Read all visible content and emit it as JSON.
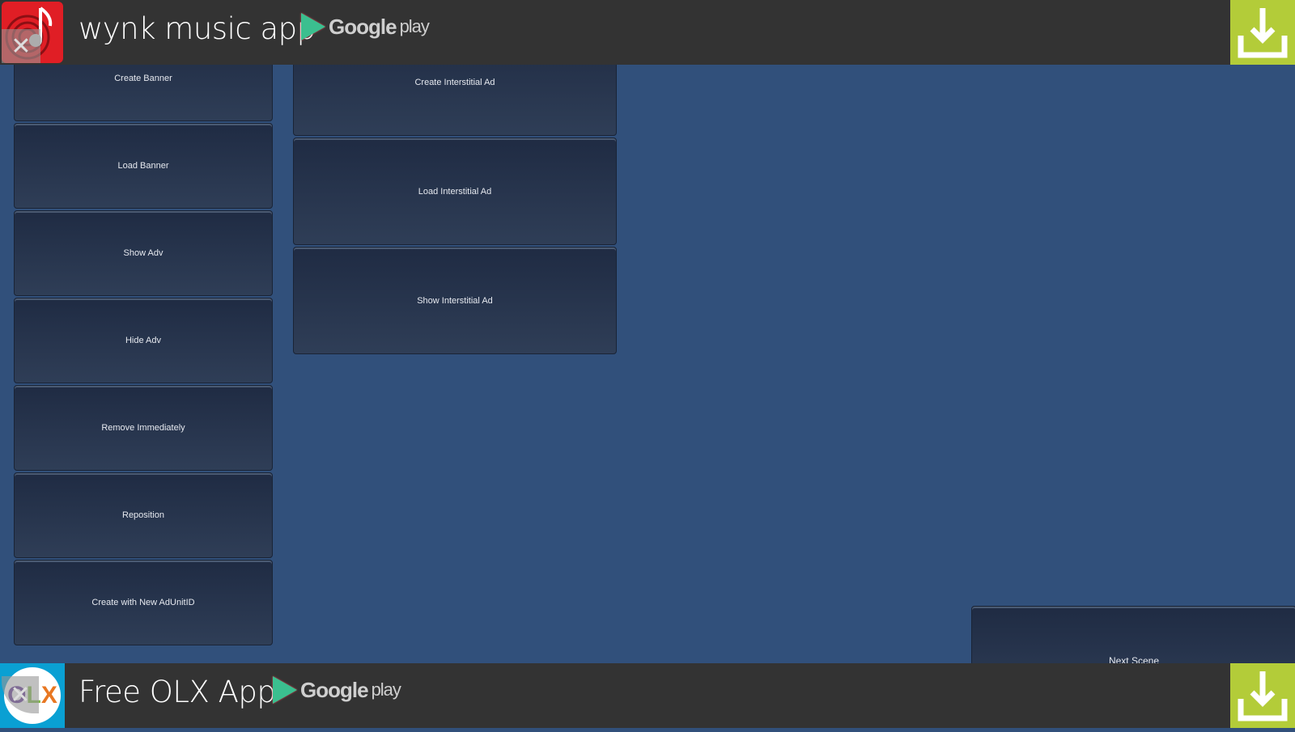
{
  "top_ad": {
    "title": "wynk music app",
    "store": "Google",
    "store_suffix": "play",
    "logo_color": "#e01e25",
    "download_color": "#b3cc39"
  },
  "bottom_ad": {
    "title": "Free OLX App",
    "store": "Google",
    "store_suffix": "play",
    "logo_bg": "#0aa0d3",
    "download_color": "#b3cc39"
  },
  "banner_buttons": [
    "Create Banner",
    "Load Banner",
    "Show Adv",
    "Hide Adv",
    "Remove Immediately",
    "Reposition",
    "Create with New AdUnitID"
  ],
  "interstitial_buttons": [
    "Create Interstitial Ad",
    "Load Interstitial Ad",
    "Show Interstitial Ad"
  ],
  "next_scene": "Next Scene"
}
